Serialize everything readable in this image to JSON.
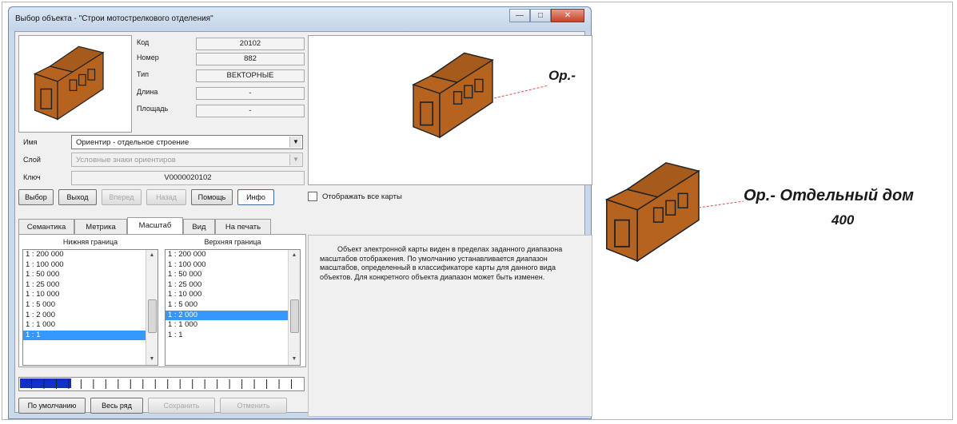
{
  "window": {
    "title": "Выбор объекта - \"Строи мотострелкового отделения\"",
    "buttons": [
      "minimize",
      "maximize",
      "close"
    ]
  },
  "attributes": [
    {
      "label": "Код",
      "value": "20102"
    },
    {
      "label": "Номер",
      "value": "882"
    },
    {
      "label": "Тип",
      "value": "ВЕКТОРНЫЕ"
    },
    {
      "label": "Длина",
      "value": "-"
    },
    {
      "label": "Площадь",
      "value": "-"
    }
  ],
  "fields": {
    "name_label": "Имя",
    "name_value": "Ориентир - отдельное строение",
    "layer_label": "Слой",
    "layer_value": "Условные знаки ориентиров",
    "key_label": "Ключ",
    "key_value": "V0000020102"
  },
  "actions": {
    "select": "Выбор",
    "exit": "Выход",
    "forward": "Вперед",
    "back": "Назад",
    "help": "Помощь",
    "info": "Инфо"
  },
  "show_all_maps": "Отображать все карты",
  "tabs": [
    "Семантика",
    "Метрика",
    "Масштаб",
    "Вид",
    "На печать"
  ],
  "selected_tab": "Масштаб",
  "scale": {
    "lower_header": "Нижняя граница",
    "upper_header": "Верхняя граница",
    "lower_items": [
      "1 : 200 000",
      "1 : 100 000",
      "1 : 50 000",
      "1 : 25 000",
      "1 : 10 000",
      "1 : 5 000",
      "1 : 2 000",
      "1 : 1 000",
      "1 : 1"
    ],
    "lower_selected": "1 : 1",
    "upper_items": [
      "1 : 200 000",
      "1 : 100 000",
      "1 : 50 000",
      "1 : 25 000",
      "1 : 10 000",
      "1 : 5 000",
      "1 : 2 000",
      "1 : 1 000",
      "1 : 1"
    ],
    "upper_selected": "1 : 2 000",
    "ruler_fill": 0.18
  },
  "bottom_buttons": {
    "default": "По умолчанию",
    "whole_row": "Весь ряд",
    "save": "Сохранить",
    "cancel": "Отменить"
  },
  "info_text": "Объект электронной карты виден в пределах заданного диапазона масштабов отображения. По умолчанию устанавливается диапазон масштабов, определенный в классификаторе карты для данного вида объектов. Для конкретного объекта диапазон может быть изменен.",
  "preview_label": "Ор.-",
  "map": {
    "label_line1": "Ор.- Отдельный  дом",
    "label_line2": "400"
  },
  "colors": {
    "house_body": "#b5631f",
    "house_roof": "#a65a1c",
    "selection": "#3399ff",
    "ruler_fill": "#1030c8",
    "leader_line": "#e05050"
  }
}
